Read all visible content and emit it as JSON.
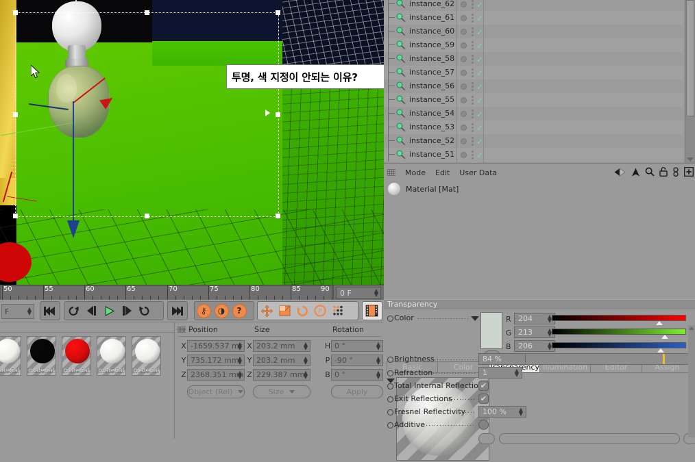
{
  "viewport": {
    "tooltip_text": "투명, 색 지정이 안되는 이유?",
    "cursor": "arrow-cursor"
  },
  "timeline": {
    "ticks": [
      50,
      55,
      60,
      65,
      70,
      75,
      80,
      85,
      90
    ],
    "frame_field_value": "0 F",
    "range_start": 50,
    "range_end": 90
  },
  "player": {
    "unit_field_value": "F",
    "buttons": [
      {
        "name": "go-to-start-button",
        "glyph": "⏮"
      },
      {
        "name": "previous-key-button",
        "glyph": "↺"
      },
      {
        "name": "step-back-button",
        "glyph": "◀|"
      },
      {
        "name": "play-forward-button",
        "glyph": "▶"
      },
      {
        "name": "step-forward-button",
        "glyph": "|▶"
      },
      {
        "name": "next-key-button",
        "glyph": "↪"
      },
      {
        "name": "go-to-end-button",
        "glyph": "⏭"
      }
    ],
    "record_buttons": [
      {
        "name": "record-active-objects-button",
        "glyph": "⚷"
      },
      {
        "name": "autokeying-button",
        "glyph": "◑"
      },
      {
        "name": "keyframe-selection-button",
        "glyph": "?"
      }
    ],
    "key_mode_buttons": [
      {
        "name": "position-key-button",
        "glyph": "✛"
      },
      {
        "name": "scale-key-button",
        "glyph": "▣"
      },
      {
        "name": "rotation-key-button",
        "glyph": "↻"
      },
      {
        "name": "parameter-key-button",
        "glyph": "P"
      },
      {
        "name": "point-level-animation-button",
        "glyph": "⁘"
      }
    ],
    "render_button": {
      "name": "render-view-button",
      "glyph": "🎞"
    }
  },
  "material_manager": {
    "materials": [
      {
        "label": "material",
        "color": "#f0efe8",
        "type": "sphere"
      },
      {
        "label": "material",
        "color": "#060606",
        "type": "sphere"
      },
      {
        "label": "material",
        "color": "#d40b0b",
        "type": "sphere"
      },
      {
        "label": "material",
        "color": "#eeeeea",
        "type": "sphere"
      },
      {
        "label": "material",
        "color": "#eeeeea",
        "type": "sphere"
      }
    ]
  },
  "coordinates": {
    "headers": [
      "Position",
      "Size",
      "Rotation"
    ],
    "rows": [
      {
        "pos_axis": "X",
        "pos_value": "-1659.537 mr",
        "size_axis": "X",
        "size_value": "203.2 mm",
        "rot_axis": "H",
        "rot_value": "0 °"
      },
      {
        "pos_axis": "Y",
        "pos_value": "735.172 mm",
        "size_axis": "Y",
        "size_value": "203.2 mm",
        "rot_axis": "P",
        "rot_value": "-90 °"
      },
      {
        "pos_axis": "Z",
        "pos_value": "2368.351 mm",
        "size_axis": "Z",
        "size_value": "229.387 mm",
        "rot_axis": "B",
        "rot_value": "0 °"
      }
    ],
    "mode_dropdown": "Object (Rel)",
    "size_dropdown": "Size",
    "apply_button": "Apply"
  },
  "object_manager": {
    "items": [
      {
        "name": "instance_62"
      },
      {
        "name": "instance_61"
      },
      {
        "name": "instance_60"
      },
      {
        "name": "instance_59"
      },
      {
        "name": "instance_58"
      },
      {
        "name": "instance_57"
      },
      {
        "name": "instance_56"
      },
      {
        "name": "instance_55"
      },
      {
        "name": "instance_54"
      },
      {
        "name": "instance_53"
      },
      {
        "name": "instance_52"
      },
      {
        "name": "instance_51"
      }
    ]
  },
  "attribute_manager": {
    "menus": [
      "Mode",
      "Edit",
      "User Data"
    ],
    "header_icons": [
      "back-arrow-icon",
      "forward-arrow-icon",
      "up-arrow-icon",
      "search-icon",
      "lock-icon",
      "link-icon",
      "add-icon"
    ],
    "title": "Material [Mat]",
    "tabs": [
      {
        "label": "Basic",
        "selected": false
      },
      {
        "label": "Color",
        "selected": false
      },
      {
        "label": "Transparency",
        "selected": true
      },
      {
        "label": "Illumination",
        "selected": false
      },
      {
        "label": "Editor",
        "selected": false
      },
      {
        "label": "Assign",
        "selected": false
      }
    ],
    "section_title": "Transparency",
    "color": {
      "label": "Color",
      "swatch_hex": "#ccd5ce",
      "channels": [
        {
          "name": "R",
          "value": "204",
          "pct": 80,
          "from": "#000000",
          "to": "#ff0000"
        },
        {
          "name": "G",
          "value": "213",
          "pct": 84,
          "from": "#000000",
          "to": "#7cf028"
        },
        {
          "name": "B",
          "value": "206",
          "pct": 81,
          "from": "#000000",
          "to": "#2b5fc4"
        }
      ]
    },
    "fields": [
      {
        "label": "Brightness",
        "value": "84 %",
        "slider_pct": 84
      },
      {
        "label": "Refraction",
        "value": "1"
      },
      {
        "label": "Total Internal Reflection",
        "checkbox": true
      },
      {
        "label": "Exit Reflections",
        "checkbox": true
      },
      {
        "label": "Fresnel Reflectivity",
        "value": "100 %"
      },
      {
        "label": "Additive",
        "checkbox": false
      }
    ]
  },
  "colors": {
    "panel_bg": "#9a9a9a",
    "accent_orange": "#f08a4b",
    "check_green": "#6ee49a",
    "floor_green": "#4fc000"
  }
}
